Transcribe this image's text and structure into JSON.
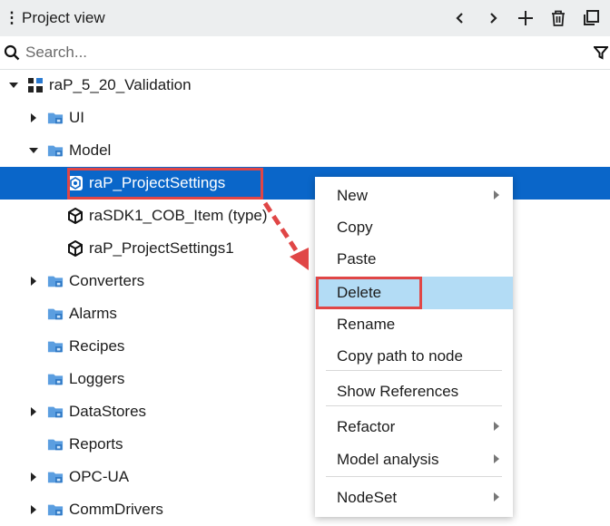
{
  "header": {
    "title": "Project view",
    "menu_icon": "kebab-icon",
    "back_icon": "chevron-left-icon",
    "forward_icon": "chevron-right-icon",
    "add_icon": "plus-icon",
    "delete_icon": "trash-icon",
    "popout_icon": "popout-icon"
  },
  "search": {
    "placeholder": "Search...",
    "value": "",
    "filter_icon": "filter-icon"
  },
  "tree": [
    {
      "label": "raP_5_20_Validation",
      "arrow": "down",
      "icon": "project-icon",
      "depth": 0
    },
    {
      "label": "UI",
      "arrow": "right",
      "icon": "folder-ui-icon",
      "depth": 1
    },
    {
      "label": "Model",
      "arrow": "down",
      "icon": "folder-model-icon",
      "depth": 1
    },
    {
      "label": "raP_ProjectSettings",
      "arrow": "none",
      "icon": "object-icon",
      "depth": 2,
      "selected": true
    },
    {
      "label": "raSDK1_COB_Item (type)",
      "arrow": "none",
      "icon": "type-icon",
      "depth": 2
    },
    {
      "label": "raP_ProjectSettings1",
      "arrow": "none",
      "icon": "type-icon",
      "depth": 2
    },
    {
      "label": "Converters",
      "arrow": "right",
      "icon": "folder-converters-icon",
      "depth": 1
    },
    {
      "label": "Alarms",
      "arrow": "none",
      "icon": "folder-alarms-icon",
      "depth": 1
    },
    {
      "label": "Recipes",
      "arrow": "none",
      "icon": "folder-recipes-icon",
      "depth": 1
    },
    {
      "label": "Loggers",
      "arrow": "none",
      "icon": "folder-loggers-icon",
      "depth": 1
    },
    {
      "label": "DataStores",
      "arrow": "right",
      "icon": "folder-datastores-icon",
      "depth": 1
    },
    {
      "label": "Reports",
      "arrow": "none",
      "icon": "folder-reports-icon",
      "depth": 1
    },
    {
      "label": "OPC-UA",
      "arrow": "right",
      "icon": "folder-opcua-icon",
      "depth": 1
    },
    {
      "label": "CommDrivers",
      "arrow": "right",
      "icon": "folder-commdrivers-icon",
      "depth": 1
    }
  ],
  "context_menu": {
    "items": [
      {
        "label": "New",
        "submenu": true
      },
      {
        "label": "Copy",
        "submenu": false
      },
      {
        "label": "Paste",
        "submenu": false
      },
      {
        "label": "Delete",
        "submenu": false,
        "highlighted": true
      },
      {
        "label": "Rename",
        "submenu": false
      },
      {
        "label": "Copy path to node",
        "submenu": false
      },
      {
        "label": "Show References",
        "submenu": false
      },
      {
        "label": "Refactor",
        "submenu": true
      },
      {
        "label": "Model analysis",
        "submenu": true
      },
      {
        "label": "NodeSet",
        "submenu": true
      }
    ]
  },
  "annotation": {
    "color": "#e04646"
  },
  "colors": {
    "selection": "#0a66c9",
    "menu_highlight": "#b3dcf5",
    "folder_blue": "#4a90d9",
    "header_bg": "#eceeef"
  }
}
